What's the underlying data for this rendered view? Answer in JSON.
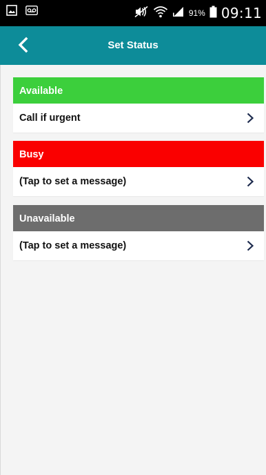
{
  "status_bar": {
    "battery_percent": "91%",
    "time": "09:11",
    "icons": [
      "image-icon",
      "voicemail-icon",
      "mute-icon",
      "wifi-icon",
      "signal-icon",
      "battery-icon"
    ]
  },
  "header": {
    "title": "Set Status",
    "back_icon": "chevron-left-icon"
  },
  "statuses": [
    {
      "label": "Available",
      "message": "Call if urgent",
      "color": "#3ccf3c"
    },
    {
      "label": "Busy",
      "message": "(Tap to set a message)",
      "color": "#fa0000"
    },
    {
      "label": "Unavailable",
      "message": "(Tap to set a message)",
      "color": "#6d6d6d"
    }
  ],
  "colors": {
    "app_bar": "#0d8c99",
    "chevron": "#1c2a4d"
  }
}
